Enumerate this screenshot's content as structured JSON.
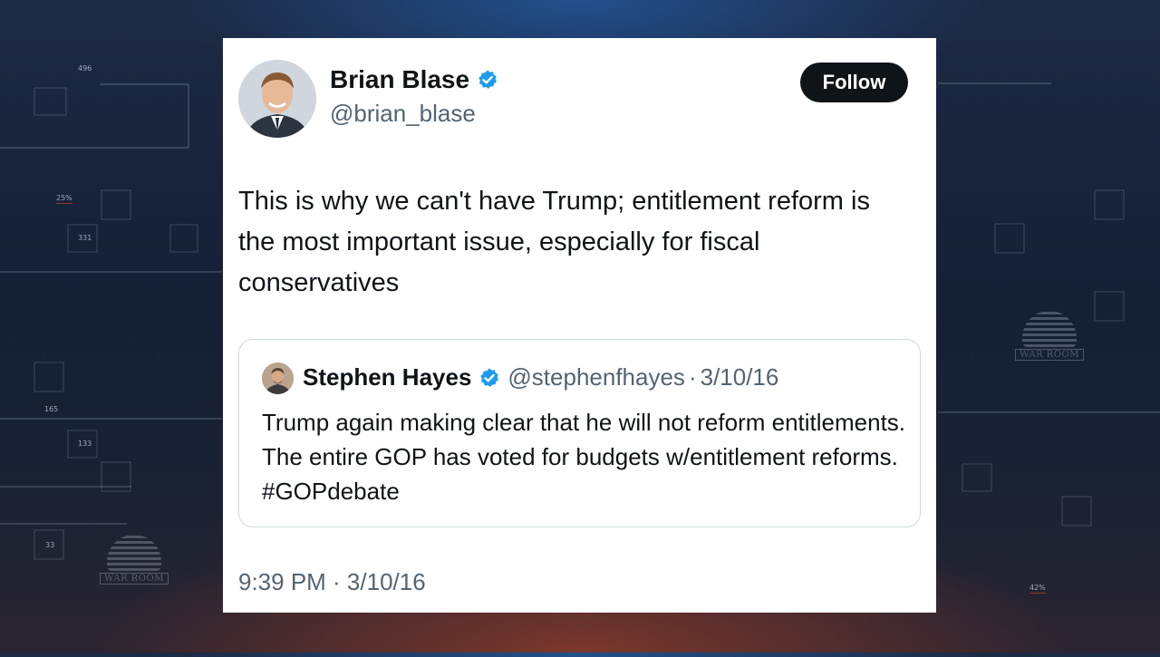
{
  "background": {
    "numbers": [
      "496",
      "25%",
      "331",
      "165",
      "133",
      "33",
      "42%"
    ],
    "watermark": "WAR ROOM",
    "colors": {
      "base": "#142036",
      "glow_top": "#286ec8",
      "glow_bottom": "#be4628"
    }
  },
  "tweet": {
    "author": {
      "name": "Brian Blase",
      "handle": "@brian_blase",
      "verified": true,
      "avatar_icon": "profile-photo"
    },
    "follow_label": "Follow",
    "text": "This is why we can't have Trump; entitlement reform is the most important issue, especially for fiscal conservatives",
    "quoted": {
      "name": "Stephen Hayes",
      "handle": "@stephenfhayes",
      "separator": "·",
      "date": "3/10/16",
      "verified": true,
      "text": "Trump again making clear that he will not reform entitlements. The entire GOP has voted for budgets w/entitlement reforms. #GOPdebate"
    },
    "timestamp": "9:39 PM · 3/10/16"
  },
  "colors": {
    "verified_blue": "#1d9bf0",
    "text_primary": "#0f1419",
    "text_secondary": "#536471",
    "follow_bg": "#0f1419"
  }
}
